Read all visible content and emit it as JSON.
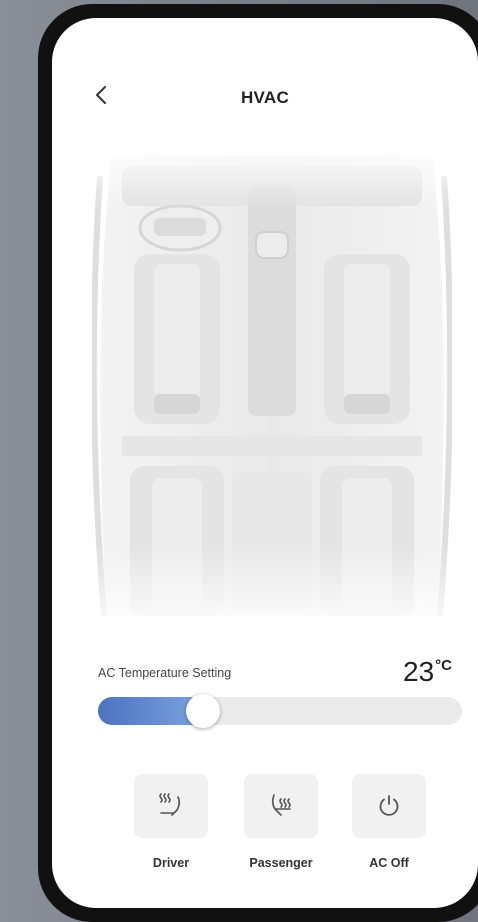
{
  "header": {
    "title": "HVAC",
    "back_icon": "chevron-left-icon"
  },
  "temperature": {
    "label": "AC Temperature Setting",
    "value": "23",
    "unit": "°C",
    "slider_fraction": 0.24,
    "accent": "#4a73c1"
  },
  "controls": [
    {
      "label": "Driver",
      "icon": "seat-heat-icon"
    },
    {
      "label": "Passenger",
      "icon": "seat-ventilation-icon"
    },
    {
      "label": "AC Off",
      "icon": "power-icon"
    }
  ]
}
